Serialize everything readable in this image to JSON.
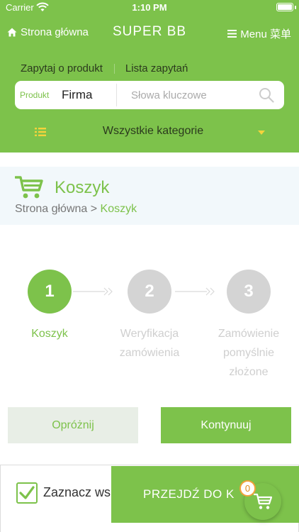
{
  "status_bar": {
    "carrier": "Carrier",
    "time": "1:10 PM"
  },
  "header": {
    "home_label": "Strona główna",
    "brand": "SUPER BB",
    "menu_label": "Menu 菜单",
    "inquiry_link": "Zapytaj o produkt",
    "inquiry_list_link": "Lista zapytań",
    "search": {
      "type_label": "Produkt",
      "type_value": "Firma",
      "placeholder": "Słowa kluczowe"
    },
    "category": "Wszystkie kategorie"
  },
  "page": {
    "title": "Koszyk",
    "breadcrumb_home": "Strona główna",
    "breadcrumb_separator": ">",
    "breadcrumb_current": "Koszyk"
  },
  "steps": [
    {
      "number": "1",
      "label_line1": "Koszyk",
      "label_line2": "",
      "label_line3": "",
      "active": true
    },
    {
      "number": "2",
      "label_line1": "Weryfikacja",
      "label_line2": "zamówienia",
      "label_line3": "",
      "active": false
    },
    {
      "number": "3",
      "label_line1": "Zamówienie",
      "label_line2": "pomyślnie",
      "label_line3": "złożone",
      "active": false
    }
  ],
  "actions": {
    "clear_label": "Opróżnij",
    "continue_label": "Kontynuuj"
  },
  "footer": {
    "select_all_label": "Zaznacz ws",
    "checkout_label": "PRZEJDŹ DO K",
    "cart_count": "0"
  },
  "colors": {
    "accent": "#7dc24b",
    "inactive": "#d4d4d4",
    "badge": "#f0a13a",
    "icon_yellow": "#f5d33c"
  }
}
